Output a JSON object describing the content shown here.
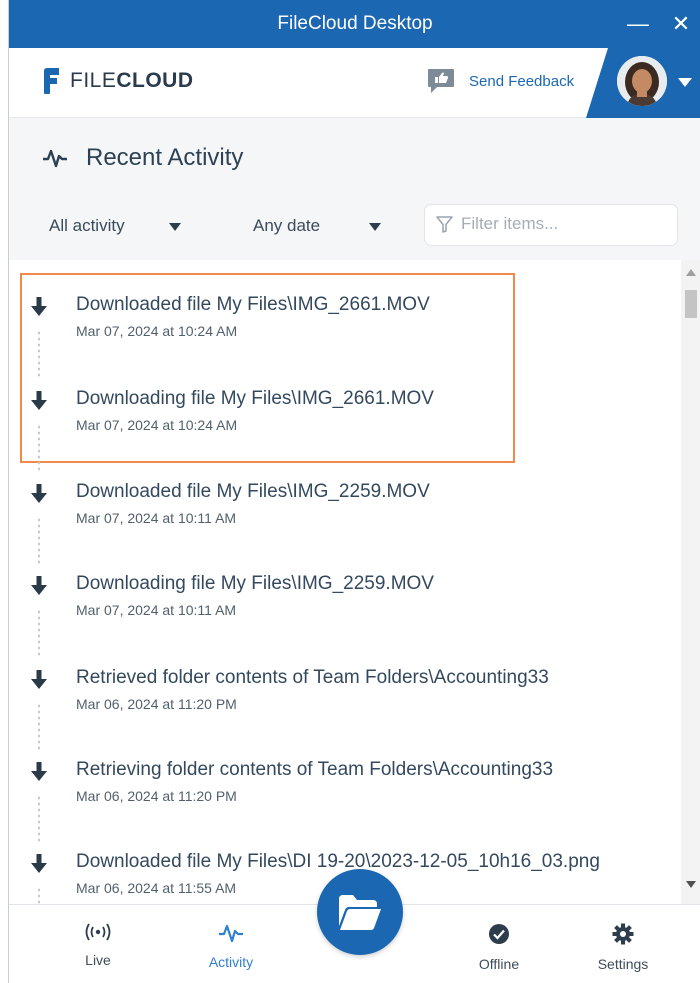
{
  "window": {
    "title": "FileCloud Desktop",
    "minimize_label": "—",
    "close_label": "✕"
  },
  "header": {
    "logo_text_light": "FILE",
    "logo_text_bold": "CLOUD",
    "feedback_label": "Send Feedback",
    "brand_color": "#1b67b2"
  },
  "section": {
    "title": "Recent Activity",
    "icon": "activity-pulse-icon"
  },
  "filters": {
    "activity_selected": "All activity",
    "date_selected": "Any date",
    "search_placeholder": "Filter items..."
  },
  "activities": [
    {
      "message": "Downloaded file My Files\\IMG_2661.MOV",
      "time": "Mar 07, 2024 at 10:24 AM",
      "icon": "download-arrow-icon"
    },
    {
      "message": "Downloading file My Files\\IMG_2661.MOV",
      "time": "Mar 07, 2024 at 10:24 AM",
      "icon": "download-arrow-icon"
    },
    {
      "message": "Downloaded file My Files\\IMG_2259.MOV",
      "time": "Mar 07, 2024 at 10:11 AM",
      "icon": "download-arrow-icon"
    },
    {
      "message": "Downloading file My Files\\IMG_2259.MOV",
      "time": "Mar 07, 2024 at 10:11 AM",
      "icon": "download-arrow-icon"
    },
    {
      "message": "Retrieved folder contents of Team Folders\\Accounting33",
      "time": "Mar 06, 2024 at 11:20 PM",
      "icon": "download-arrow-icon"
    },
    {
      "message": "Retrieving folder contents of Team Folders\\Accounting33",
      "time": "Mar 06, 2024 at 11:20 PM",
      "icon": "download-arrow-icon"
    },
    {
      "message": "Downloaded file My Files\\DI 19-20\\2023-12-05_10h16_03.png",
      "time": "Mar 06, 2024 at 11:55 AM",
      "icon": "download-arrow-icon"
    }
  ],
  "nav": {
    "live": "Live",
    "activity": "Activity",
    "offline": "Offline",
    "settings": "Settings",
    "active_color": "#2f7fd0"
  },
  "highlight_color": "#ef8a4b"
}
